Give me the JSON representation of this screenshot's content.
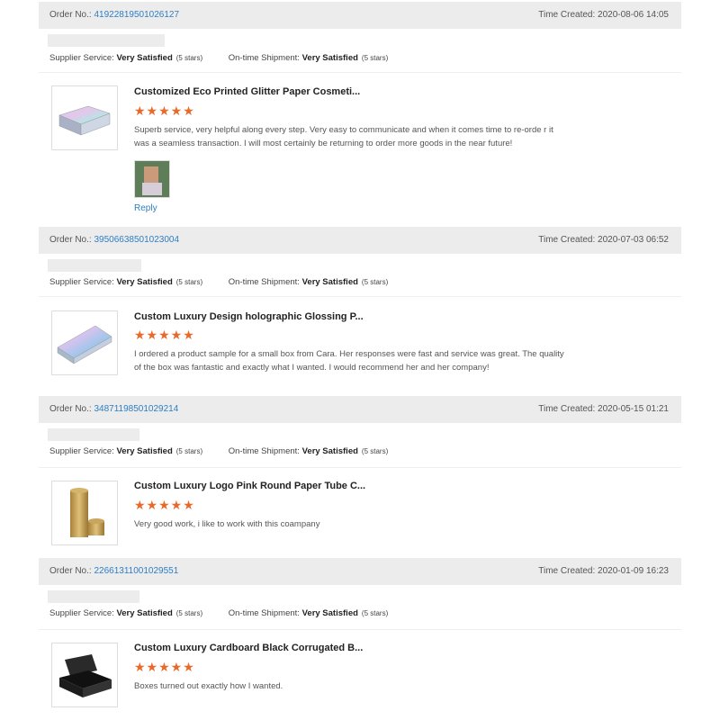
{
  "labels": {
    "order_no": "Order No.:",
    "time_created": "Time Created:",
    "supplier_service": "Supplier Service:",
    "ontime_shipment": "On-time Shipment:",
    "reply": "Reply"
  },
  "accent_color": "#e8692a",
  "link_color": "#2e7ec4",
  "reviews": [
    {
      "order_no": "41922819501026127",
      "time": "2020-08-06 14:05",
      "supplier_rating": "Very Satisfied",
      "supplier_stars": "(5 stars)",
      "shipment_rating": "Very Satisfied",
      "shipment_stars": "(5 stars)",
      "product_title": "Customized Eco Printed Glitter Paper Cosmeti...",
      "stars": "★★★★★",
      "stars_value": 5,
      "text": "Superb service, very helpful along every step. Very easy to communicate and when it comes time to re-orde r it was a seamless transaction. I will most certainly be returning to order more goods in the near future!",
      "product_icon": "holographic-box-image"
    },
    {
      "order_no": "39506638501023004",
      "time": "2020-07-03 06:52",
      "supplier_rating": "Very Satisfied",
      "supplier_stars": "(5 stars)",
      "shipment_rating": "Very Satisfied",
      "shipment_stars": "(5 stars)",
      "product_title": "Custom Luxury Design holographic Glossing P...",
      "stars": "★★★★★",
      "stars_value": 5,
      "text": "I ordered a product sample for a small box from Cara.  Her responses were fast and service was great.  The quality of the box was fantastic and exactly what I wanted.  I would recommend her and her company!",
      "product_icon": "holographic-box-image"
    },
    {
      "order_no": "34871198501029214",
      "time": "2020-05-15 01:21",
      "supplier_rating": "Very Satisfied",
      "supplier_stars": "(5 stars)",
      "shipment_rating": "Very Satisfied",
      "shipment_stars": "(5 stars)",
      "product_title": "Custom Luxury Logo Pink Round Paper Tube C...",
      "stars": "★★★★★",
      "stars_value": 5,
      "text": "Very good work, i like to work with this coampany",
      "product_icon": "gold-tube-image"
    },
    {
      "order_no": "22661311001029551",
      "time": "2020-01-09 16:23",
      "supplier_rating": "Very Satisfied",
      "supplier_stars": "(5 stars)",
      "shipment_rating": "Very Satisfied",
      "shipment_stars": "(5 stars)",
      "product_title": "Custom Luxury Cardboard Black Corrugated B...",
      "stars": "★★★★★",
      "stars_value": 5,
      "text": "Boxes turned out exactly how I wanted.",
      "product_icon": "black-box-image"
    }
  ]
}
